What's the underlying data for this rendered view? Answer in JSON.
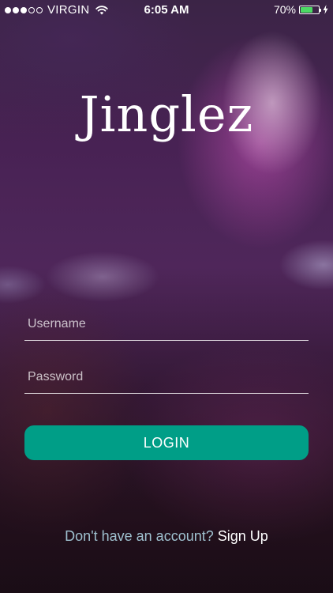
{
  "status_bar": {
    "signal_bars_filled": 3,
    "signal_bars_total": 5,
    "carrier": "VIRGIN",
    "wifi_icon": "wifi-icon",
    "time": "6:05 AM",
    "battery_percent": "70%",
    "battery_level": 0.7,
    "battery_color": "#4cd964",
    "charging_icon": "bolt-icon"
  },
  "app": {
    "logo_text": "Jinglez"
  },
  "form": {
    "username_placeholder": "Username",
    "username_value": "",
    "password_placeholder": "Password",
    "password_value": "",
    "login_label": "LOGIN",
    "login_color": "#009e87"
  },
  "footer": {
    "prompt": "Don't have an account?",
    "signup_label": "Sign Up"
  }
}
